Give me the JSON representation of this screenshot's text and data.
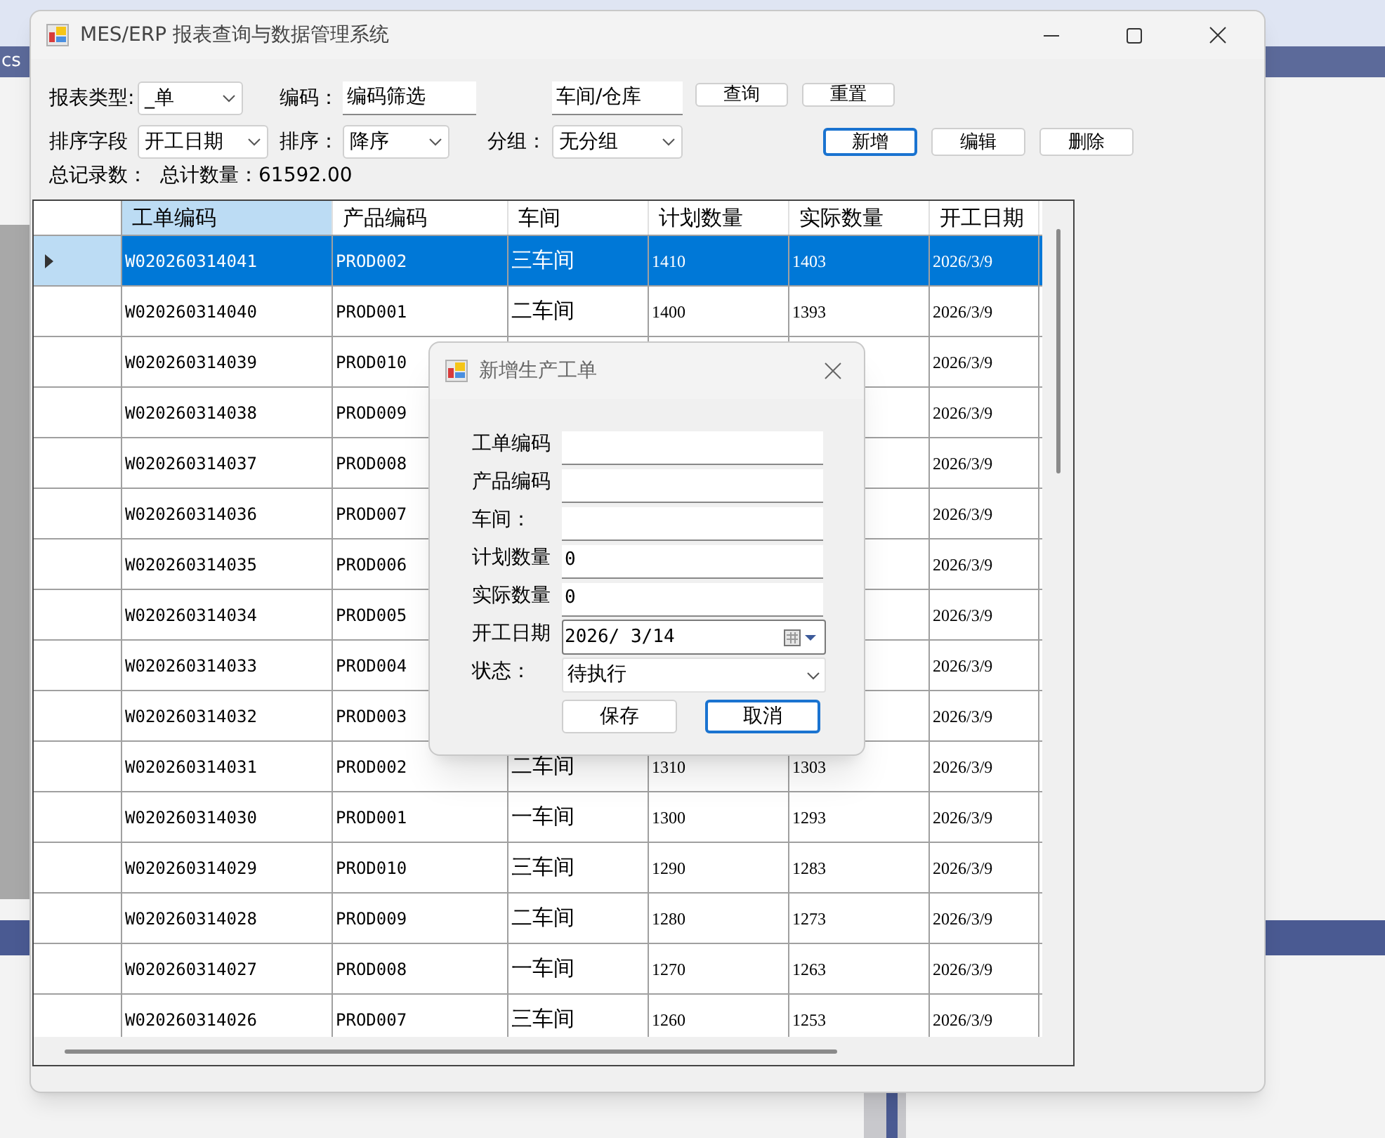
{
  "background": {
    "label": "cs"
  },
  "window": {
    "title": "MES/ERP 报表查询与数据管理系统"
  },
  "filters": {
    "report_type": {
      "label": "报表类型:",
      "value": "_单"
    },
    "code": {
      "label": "编码：",
      "value": "编码筛选"
    },
    "workshop": {
      "value": "车间/仓库"
    },
    "sort_field": {
      "label": "排序字段",
      "value": "开工日期"
    },
    "sort_order": {
      "label": "排序：",
      "value": "降序"
    },
    "group": {
      "label": "分组：",
      "value": "无分组"
    }
  },
  "query_buttons": [
    {
      "text": "查询",
      "focused": false
    },
    {
      "text": "重置",
      "focused": false
    }
  ],
  "action_buttons": [
    {
      "text": "新增",
      "focused": true
    },
    {
      "text": "编辑",
      "focused": false
    },
    {
      "text": "删除",
      "focused": false
    }
  ],
  "summary": {
    "record_count_label": "总记录数：",
    "total_label": "总计数量：61592.00"
  },
  "table": {
    "columns": [
      {
        "text": "工单编码",
        "selected": true
      },
      {
        "text": "产品编码",
        "selected": false
      },
      {
        "text": "车间",
        "selected": false
      },
      {
        "text": "计划数量",
        "selected": false
      },
      {
        "text": "实际数量",
        "selected": false
      },
      {
        "text": "开工日期",
        "selected": false
      }
    ],
    "rows": [
      {
        "selected": true,
        "work_order": "W020260314041",
        "product": "PROD002",
        "workshop": "三车间",
        "plan_qty": "1410",
        "actual_qty": "1403",
        "start_date": "2026/3/9"
      },
      {
        "selected": false,
        "work_order": "W020260314040",
        "product": "PROD001",
        "workshop": "二车间",
        "plan_qty": "1400",
        "actual_qty": "1393",
        "start_date": "2026/3/9"
      },
      {
        "selected": false,
        "work_order": "W020260314039",
        "product": "PROD010",
        "start_date": "2026/3/9"
      },
      {
        "selected": false,
        "work_order": "W020260314038",
        "product": "PROD009",
        "start_date": "2026/3/9"
      },
      {
        "selected": false,
        "work_order": "W020260314037",
        "product": "PROD008",
        "start_date": "2026/3/9"
      },
      {
        "selected": false,
        "work_order": "W020260314036",
        "product": "PROD007",
        "start_date": "2026/3/9"
      },
      {
        "selected": false,
        "work_order": "W020260314035",
        "product": "PROD006",
        "start_date": "2026/3/9"
      },
      {
        "selected": false,
        "work_order": "W020260314034",
        "product": "PROD005",
        "start_date": "2026/3/9"
      },
      {
        "selected": false,
        "work_order": "W020260314033",
        "product": "PROD004",
        "start_date": "2026/3/9"
      },
      {
        "selected": false,
        "work_order": "W020260314032",
        "product": "PROD003",
        "start_date": "2026/3/9"
      },
      {
        "selected": false,
        "work_order": "W020260314031",
        "product": "PROD002",
        "workshop": "二车间",
        "plan_qty": "1310",
        "actual_qty": "1303",
        "start_date": "2026/3/9"
      },
      {
        "selected": false,
        "work_order": "W020260314030",
        "product": "PROD001",
        "workshop": "一车间",
        "plan_qty": "1300",
        "actual_qty": "1293",
        "start_date": "2026/3/9"
      },
      {
        "selected": false,
        "work_order": "W020260314029",
        "product": "PROD010",
        "workshop": "三车间",
        "plan_qty": "1290",
        "actual_qty": "1283",
        "start_date": "2026/3/9"
      },
      {
        "selected": false,
        "work_order": "W020260314028",
        "product": "PROD009",
        "workshop": "二车间",
        "plan_qty": "1280",
        "actual_qty": "1273",
        "start_date": "2026/3/9"
      },
      {
        "selected": false,
        "work_order": "W020260314027",
        "product": "PROD008",
        "workshop": "一车间",
        "plan_qty": "1270",
        "actual_qty": "1263",
        "start_date": "2026/3/9"
      },
      {
        "selected": false,
        "work_order": "W020260314026",
        "product": "PROD007",
        "workshop": "三车间",
        "plan_qty": "1260",
        "actual_qty": "1253",
        "start_date": "2026/3/9"
      }
    ]
  },
  "dialog": {
    "title": "新增生产工单",
    "fields": [
      {
        "kind": "text",
        "label": "工单编码"
      },
      {
        "kind": "text",
        "label": "产品编码"
      },
      {
        "kind": "text",
        "label": "车间："
      },
      {
        "kind": "text",
        "label": "计划数量",
        "value": "0"
      },
      {
        "kind": "text",
        "label": "实际数量",
        "value": "0"
      },
      {
        "kind": "date",
        "label": "开工日期",
        "value": "2026/ 3/14"
      },
      {
        "kind": "combo",
        "label": "状态：",
        "value": "待执行"
      }
    ],
    "buttons": [
      {
        "text": "保存",
        "focused": false
      },
      {
        "text": "取消",
        "focused": true
      }
    ]
  }
}
